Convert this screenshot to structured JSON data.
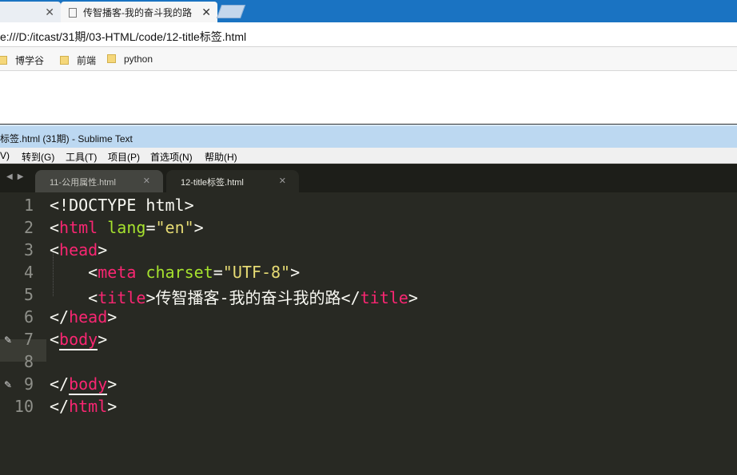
{
  "browser": {
    "active_tab_title": "传智播客-我的奋斗我的路",
    "address": "e:///D:/itcast/31期/03-HTML/code/12-title标签.html",
    "bookmarks": [
      "博学谷",
      "前端",
      "python"
    ]
  },
  "sublime": {
    "window_title": "标签.html (31期) - Sublime Text",
    "menu": [
      "V)",
      "转到(G)",
      "工具(T)",
      "项目(P)",
      "首选项(N)",
      "帮助(H)"
    ],
    "tabs": [
      {
        "label": "11-公用属性.html",
        "active": false
      },
      {
        "label": "12-title标签.html",
        "active": true
      }
    ],
    "line_numbers": [
      "1",
      "2",
      "3",
      "4",
      "5",
      "6",
      "7",
      "8",
      "9",
      "10"
    ],
    "code": {
      "l1": "<!DOCTYPE html>",
      "l2": {
        "lt": "<",
        "tag": "html",
        "attr": "lang",
        "eq": "=",
        "val": "\"en\"",
        "gt": ">"
      },
      "l3": {
        "lt": "<",
        "tag": "head",
        "gt": ">"
      },
      "l4": {
        "lt": "<",
        "tag": "meta",
        "attr": "charset",
        "eq": "=",
        "val": "\"UTF-8\"",
        "gt": ">"
      },
      "l5": {
        "lt": "<",
        "tag": "title",
        "gt": ">",
        "text": "传智播客-我的奋斗我的路",
        "lt2": "</",
        "tag2": "title",
        "gt2": ">"
      },
      "l6": {
        "lt": "</",
        "tag": "head",
        "gt": ">"
      },
      "l7": {
        "lt": "<",
        "tag": "body",
        "gt": ">"
      },
      "l9": {
        "lt": "</",
        "tag": "body",
        "gt": ">"
      },
      "l10": {
        "lt": "</",
        "tag": "html",
        "gt": ">"
      }
    }
  },
  "colors": {
    "tag": "#f92672",
    "attribute": "#a6e22e",
    "string": "#e6db74",
    "editor_bg": "#282923",
    "browser_tabbar": "#1a73c2"
  }
}
